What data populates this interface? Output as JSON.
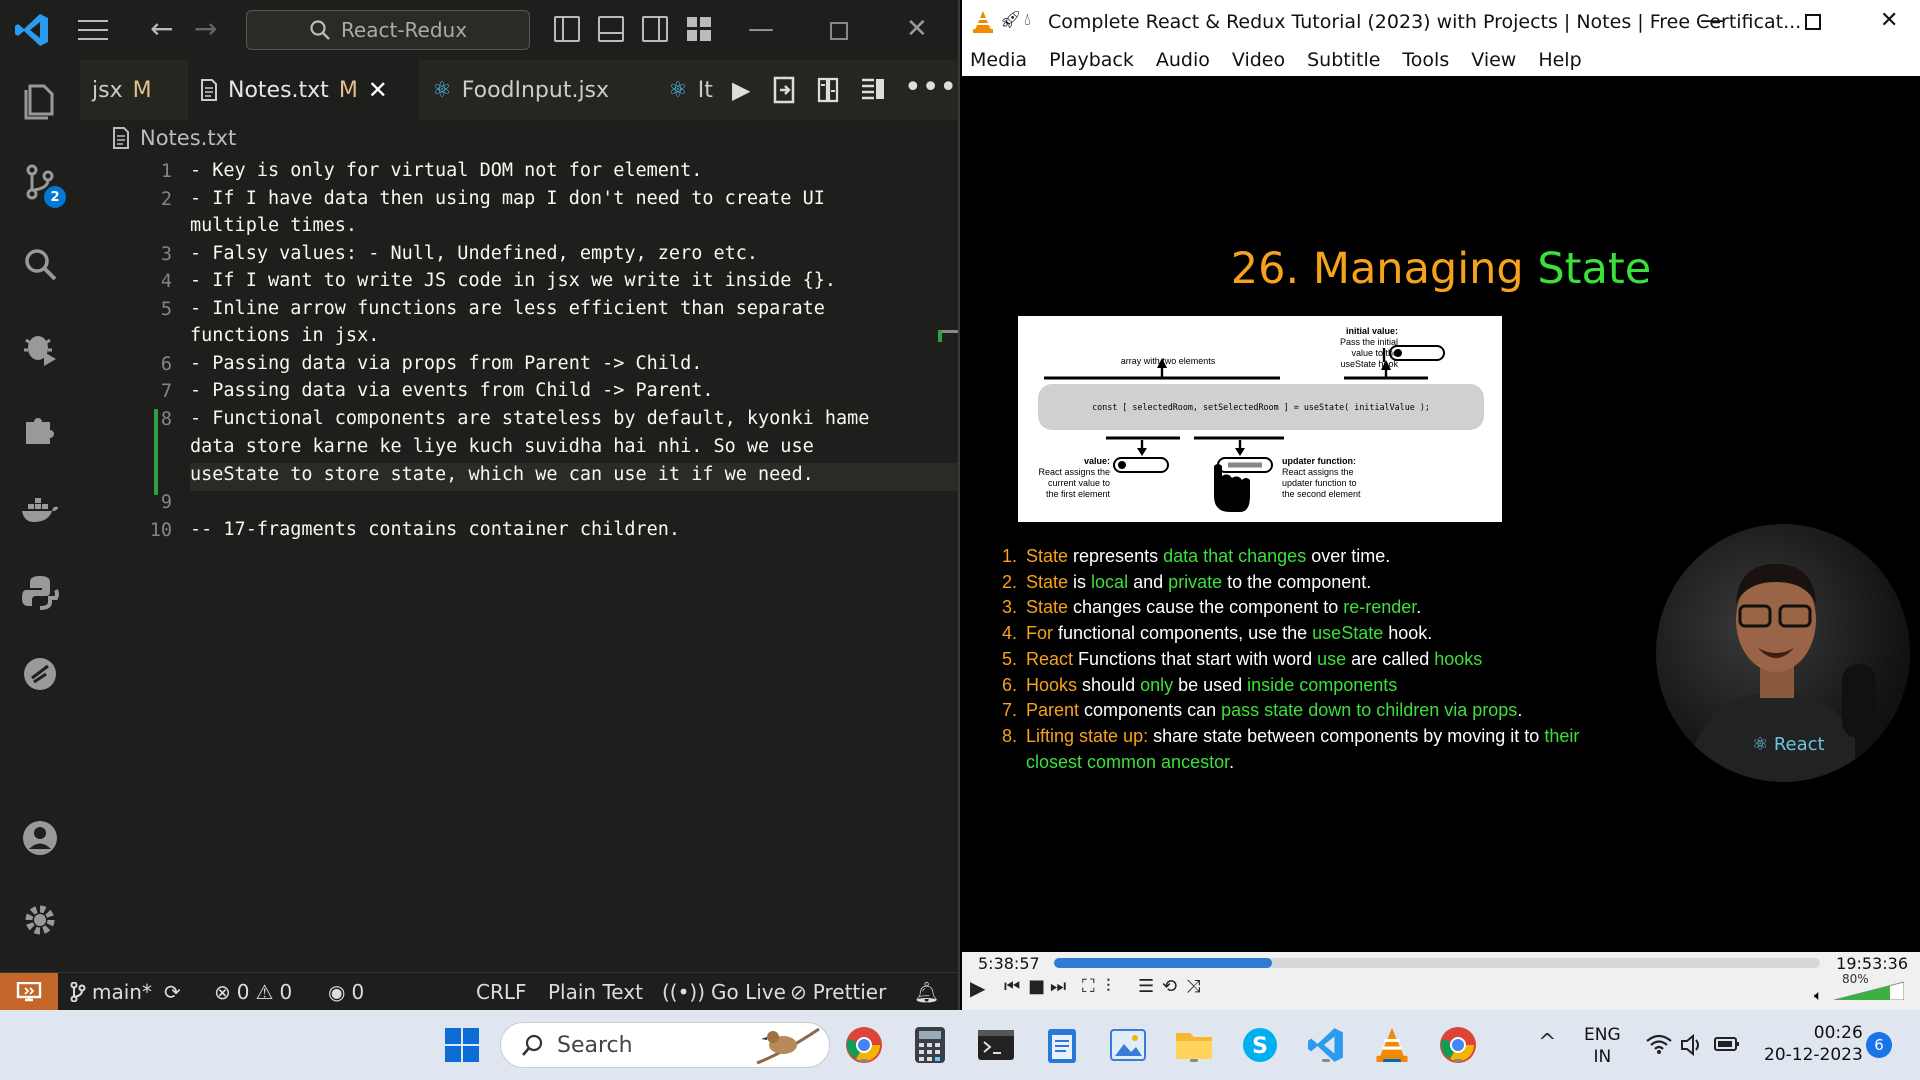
{
  "vscode": {
    "search_text": "React-Redux",
    "tabs": [
      {
        "label": "jsx",
        "status": "M"
      },
      {
        "label": "Notes.txt",
        "status": "M"
      },
      {
        "label": "FoodInput.jsx"
      },
      {
        "label": "It"
      }
    ],
    "breadcrumb": "Notes.txt",
    "source_control_badge": "2",
    "lines": [
      {
        "num": "1",
        "text": "- Key is only for virtual DOM not for element."
      },
      {
        "num": "2",
        "text": "- If I have data then using map I don't need to create UI"
      },
      {
        "num": "",
        "text": "multiple times."
      },
      {
        "num": "3",
        "text": "- Falsy values: - Null, Undefined, empty, zero etc."
      },
      {
        "num": "4",
        "text": "- If I want to write JS code in jsx we write it inside {}."
      },
      {
        "num": "5",
        "text": "- Inline arrow functions are less efficient than separate"
      },
      {
        "num": "",
        "text": "functions in jsx."
      },
      {
        "num": "6",
        "text": "- Passing data via props from Parent -> Child."
      },
      {
        "num": "7",
        "text": "- Passing data via events from Child -> Parent."
      },
      {
        "num": "8",
        "text": "- Functional components are stateless by default, kyonki hame"
      },
      {
        "num": "",
        "text": "data store karne ke liye kuch suvidha hai nhi. So we use"
      },
      {
        "num": "",
        "text": "useState to store state, which we can use it if we need."
      },
      {
        "num": "9",
        "text": ""
      },
      {
        "num": "10",
        "text": "-- 17-fragments contains container children."
      }
    ],
    "status": {
      "branch": "main*",
      "errors": "0",
      "warnings": "0",
      "ports": "0",
      "eol": "CRLF",
      "language": "Plain Text",
      "live": "Go Live",
      "prettier": "Prettier"
    }
  },
  "vlc": {
    "title": "Complete React & Redux Tutorial (2023) with Projects | Notes | Free Certificat...",
    "menu": [
      "Media",
      "Playback",
      "Audio",
      "Video",
      "Subtitle",
      "Tools",
      "View",
      "Help"
    ],
    "slide": {
      "title_num": "26.",
      "title_word1": "Managing",
      "title_word2": "State",
      "diagram": {
        "initial_label": "initial value:",
        "initial_desc1": "Pass the initial",
        "initial_desc2": "value to the",
        "initial_desc3": "useState hook",
        "array_label": "array with two elements",
        "code": "const [ selectedRoom, setSelectedRoom ] = useState( initialValue );",
        "value_label": "value:",
        "value_desc1": "React assigns the",
        "value_desc2": "current value to",
        "value_desc3": "the first element",
        "updater_label": "updater function:",
        "updater_desc1": "React assigns the",
        "updater_desc2": "updater function to",
        "updater_desc3": "the second element"
      },
      "points": [
        {
          "n": "1.",
          "parts": [
            {
              "t": "State",
              "c": "or"
            },
            {
              "t": " represents ",
              "c": ""
            },
            {
              "t": "data that changes",
              "c": "gr"
            },
            {
              "t": " over time.",
              "c": ""
            }
          ]
        },
        {
          "n": "2.",
          "parts": [
            {
              "t": "State",
              "c": "or"
            },
            {
              "t": " is ",
              "c": ""
            },
            {
              "t": "local",
              "c": "gr"
            },
            {
              "t": " and ",
              "c": ""
            },
            {
              "t": "private",
              "c": "gr"
            },
            {
              "t": " to the component.",
              "c": ""
            }
          ]
        },
        {
          "n": "3.",
          "parts": [
            {
              "t": "State",
              "c": "or"
            },
            {
              "t": " changes cause the component to ",
              "c": ""
            },
            {
              "t": "re-render",
              "c": "gr"
            },
            {
              "t": ".",
              "c": ""
            }
          ]
        },
        {
          "n": "4.",
          "parts": [
            {
              "t": "For",
              "c": "or"
            },
            {
              "t": " functional components, use the ",
              "c": ""
            },
            {
              "t": "useState",
              "c": "gr"
            },
            {
              "t": " hook.",
              "c": ""
            }
          ]
        },
        {
          "n": "5.",
          "parts": [
            {
              "t": "React",
              "c": "or"
            },
            {
              "t": " Functions that start with word ",
              "c": ""
            },
            {
              "t": "use",
              "c": "gr"
            },
            {
              "t": " are called ",
              "c": ""
            },
            {
              "t": "hooks",
              "c": "gr"
            }
          ]
        },
        {
          "n": "6.",
          "parts": [
            {
              "t": "Hooks",
              "c": "or"
            },
            {
              "t": " should ",
              "c": ""
            },
            {
              "t": "only",
              "c": "gr"
            },
            {
              "t": " be used ",
              "c": ""
            },
            {
              "t": "inside components",
              "c": "gr"
            }
          ]
        },
        {
          "n": "7.",
          "parts": [
            {
              "t": "Parent",
              "c": "or"
            },
            {
              "t": " components can ",
              "c": ""
            },
            {
              "t": "pass state down to children via props",
              "c": "gr"
            },
            {
              "t": ".",
              "c": ""
            }
          ]
        },
        {
          "n": "8.",
          "parts": [
            {
              "t": "Lifting state up:",
              "c": "or"
            },
            {
              "t": " share state between components by moving it to ",
              "c": ""
            },
            {
              "t": "their closest common ancestor",
              "c": "gr"
            },
            {
              "t": ".",
              "c": ""
            }
          ]
        }
      ]
    },
    "time_elapsed": "5:38:57",
    "time_total": "19:53:36",
    "progress_fraction": 0.284,
    "volume": "80%",
    "volume_fraction": 0.8
  },
  "taskbar": {
    "search_placeholder": "Search",
    "lang1": "ENG",
    "lang2": "IN",
    "time": "00:26",
    "date": "20-12-2023",
    "notifications": "6"
  },
  "colors": {
    "accent_orange": "#f7a21b",
    "accent_green": "#3be03b",
    "vscode_bg": "#1e1f1c",
    "remote_orange": "#c4652a"
  }
}
